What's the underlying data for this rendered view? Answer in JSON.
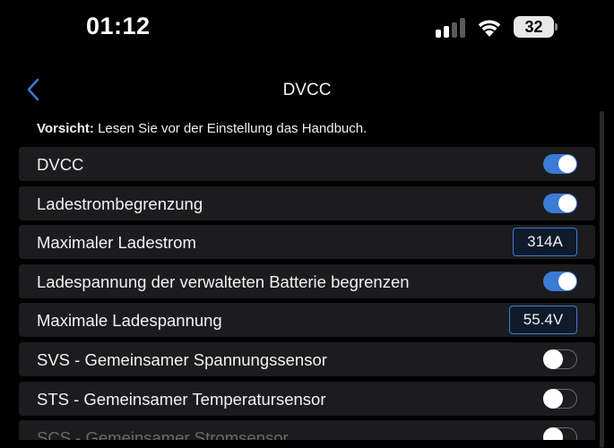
{
  "status_bar": {
    "time": "01:12",
    "battery_level": "32",
    "signal_bars_active": 2,
    "signal_bars_total": 4
  },
  "navbar": {
    "title": "DVCC",
    "back_icon": "chevron-left-icon"
  },
  "notice": {
    "bold": "Vorsicht:",
    "text": " Lesen Sie vor der Einstellung das Handbuch."
  },
  "settings": [
    {
      "label": "DVCC",
      "type": "toggle",
      "on": true
    },
    {
      "label": "Ladestrombegrenzung",
      "type": "toggle",
      "on": true
    },
    {
      "label": "Maximaler Ladestrom",
      "type": "value",
      "value": "314A"
    },
    {
      "label": "Ladespannung der verwalteten Batterie begrenzen",
      "type": "toggle",
      "on": true
    },
    {
      "label": "Maximale Ladespannung",
      "type": "value",
      "value": "55.4V"
    },
    {
      "label": "SVS - Gemeinsamer Spannungssensor",
      "type": "toggle",
      "on": false
    },
    {
      "label": "STS - Gemeinsamer Temperatursensor",
      "type": "toggle",
      "on": false
    },
    {
      "label": "SCS - Gemeinsamer Stromsensor",
      "type": "toggle",
      "on": false
    }
  ],
  "colors": {
    "accent": "#3a7bd5",
    "row_bg": "#1c1c1e",
    "background": "#000000"
  }
}
